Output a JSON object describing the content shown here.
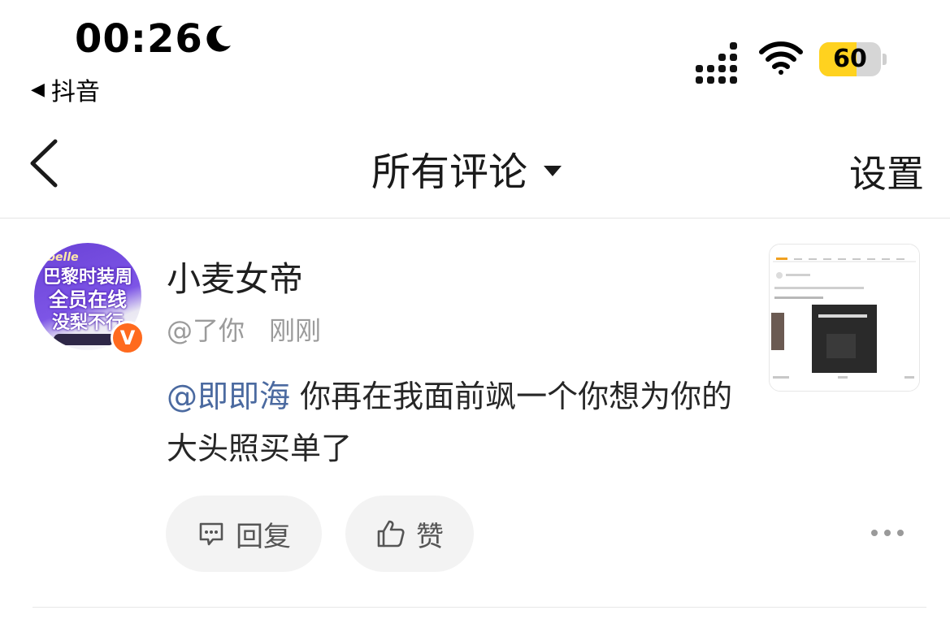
{
  "status_bar": {
    "time": "00:26",
    "back_app_label": "抖音",
    "battery_percent": "60",
    "battery_level": 0.6
  },
  "nav": {
    "title": "所有评论",
    "settings_label": "设置"
  },
  "comment": {
    "avatar": {
      "brand": "belle",
      "line1": "巴黎时装周",
      "line2": "全员在线",
      "line3": "没梨不行"
    },
    "verified_badge": "V",
    "username": "小麦女帝",
    "reply_to": "@了你",
    "time": "刚刚",
    "mention": "@即即海",
    "text": " 你再在我面前飒一个你想为你的大头照买单了",
    "reply_label": "回复",
    "like_label": "赞"
  },
  "colors": {
    "mention": "#4b6aa0",
    "battery": "#ffd21f",
    "verified": "#ff6a1e"
  }
}
